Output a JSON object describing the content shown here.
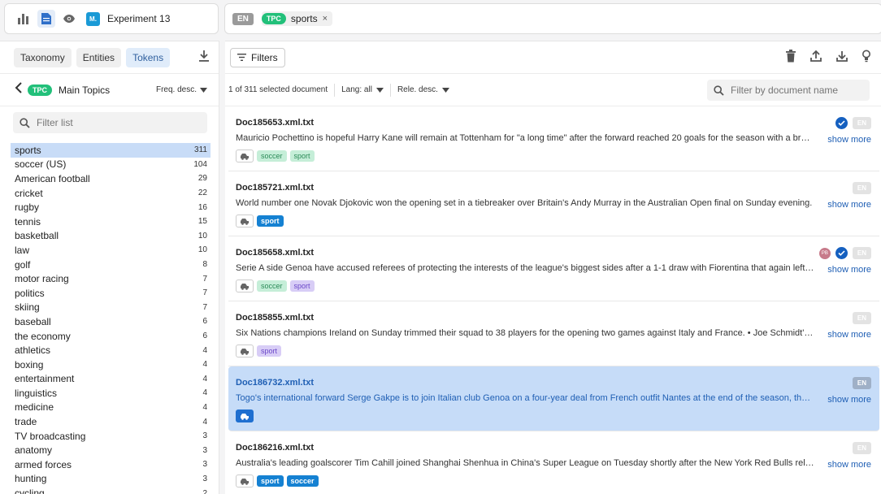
{
  "header": {
    "project_logo": "M.",
    "project_name": "Experiment 13",
    "lang": "EN",
    "topic_chip": "TPC",
    "topic_label": "sports",
    "remove": "×"
  },
  "left": {
    "tabs": [
      {
        "label": "Taxonomy"
      },
      {
        "label": "Entities"
      },
      {
        "label": "Tokens"
      }
    ],
    "topic_chip": "TPC",
    "topic_title": "Main Topics",
    "sort_label": "Freq. desc.",
    "filter_placeholder": "Filter list",
    "topics": [
      {
        "name": "sports",
        "count": "311"
      },
      {
        "name": "soccer (US)",
        "count": "104"
      },
      {
        "name": "American football",
        "count": "29"
      },
      {
        "name": "cricket",
        "count": "22"
      },
      {
        "name": "rugby",
        "count": "16"
      },
      {
        "name": "tennis",
        "count": "15"
      },
      {
        "name": "basketball",
        "count": "10"
      },
      {
        "name": "law",
        "count": "10"
      },
      {
        "name": "golf",
        "count": "8"
      },
      {
        "name": "motor racing",
        "count": "7"
      },
      {
        "name": "politics",
        "count": "7"
      },
      {
        "name": "skiing",
        "count": "7"
      },
      {
        "name": "baseball",
        "count": "6"
      },
      {
        "name": "the economy",
        "count": "6"
      },
      {
        "name": "athletics",
        "count": "4"
      },
      {
        "name": "boxing",
        "count": "4"
      },
      {
        "name": "entertainment",
        "count": "4"
      },
      {
        "name": "linguistics",
        "count": "4"
      },
      {
        "name": "medicine",
        "count": "4"
      },
      {
        "name": "trade",
        "count": "4"
      },
      {
        "name": "TV broadcasting",
        "count": "3"
      },
      {
        "name": "anatomy",
        "count": "3"
      },
      {
        "name": "armed forces",
        "count": "3"
      },
      {
        "name": "hunting",
        "count": "3"
      },
      {
        "name": "cycling",
        "count": "2"
      }
    ]
  },
  "main": {
    "filters_label": "Filters",
    "selected_info": "1 of 311 selected document",
    "lang_label": "Lang: all",
    "rel_label": "Rele. desc.",
    "doc_search_placeholder": "Filter by document name",
    "show_more": "show more",
    "lang_badge": "EN",
    "docs": [
      {
        "name": "Doc185653.xml.txt",
        "snippet": "Mauricio Pochettino is hopeful Harry Kane will remain at Tottenham for \"a long time\" after the forward reached 20 goals for the season with a brace in the win over Stoke City on Sunday.",
        "tags": [
          {
            "label": "soccer",
            "style": "soccer-l"
          },
          {
            "label": "sport",
            "style": "sport-l"
          }
        ],
        "checked": true,
        "avatar": ""
      },
      {
        "name": "Doc185721.xml.txt",
        "snippet": "World number one Novak Djokovic won the opening set in a tiebreaker over Britain's Andy Murray in the Australian Open final on Sunday evening.",
        "tags": [
          {
            "label": "sport",
            "style": "sport-b"
          }
        ],
        "checked": false,
        "avatar": ""
      },
      {
        "name": "Doc185658.xml.txt",
        "snippet": "Serie A side Genoa have accused referees of protecting the interests of the league's biggest sides after a 1-1 draw with Fiorentina that again left them without a win.",
        "tags": [
          {
            "label": "soccer",
            "style": "soccer-l"
          },
          {
            "label": "sport",
            "style": "sport-p"
          }
        ],
        "checked": true,
        "avatar": "PB"
      },
      {
        "name": "Doc185855.xml.txt",
        "snippet": "Six Nations champions Ireland on Sunday trimmed their squad to 38 players for the opening two games against Italy and France.  •  Joe Schmidt's side",
        "tags": [
          {
            "label": "sport",
            "style": "sport-p"
          }
        ],
        "checked": false,
        "avatar": ""
      },
      {
        "name": "Doc186732.xml.txt",
        "snippet": "Togo's international forward Serge Gakpe is to join Italian club Genoa on a four-year deal from French outfit Nantes at the end of the season, the club said.",
        "tags": [],
        "checked": false,
        "avatar": ""
      },
      {
        "name": "Doc186216.xml.txt",
        "snippet": "Australia's leading goalscorer Tim Cahill joined Shanghai Shenhua in China's Super League on Tuesday shortly after the New York Red Bulls released him.",
        "tags": [
          {
            "label": "sport",
            "style": "sport-b"
          },
          {
            "label": "soccer",
            "style": "soccer-b"
          }
        ],
        "checked": false,
        "avatar": ""
      }
    ]
  }
}
